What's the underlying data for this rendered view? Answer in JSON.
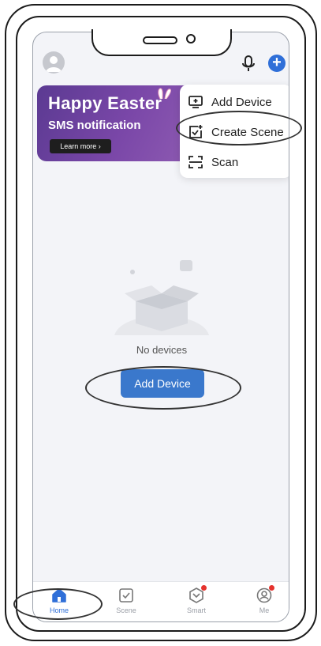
{
  "banner": {
    "title": "Happy Easter",
    "subtitle": "SMS notification",
    "button_label": "Learn more ›"
  },
  "menu": {
    "items": [
      {
        "label": "Add Device",
        "icon": "device-plus-icon"
      },
      {
        "label": "Create Scene",
        "icon": "scene-plus-icon"
      },
      {
        "label": "Scan",
        "icon": "scan-icon"
      }
    ]
  },
  "main": {
    "empty_text": "No devices",
    "add_device_label": "Add Device"
  },
  "tabbar": {
    "tabs": [
      {
        "label": "Home",
        "icon": "home-icon",
        "active": true
      },
      {
        "label": "Scene",
        "icon": "checkbox-icon",
        "active": false
      },
      {
        "label": "Smart",
        "icon": "smart-icon",
        "active": false
      },
      {
        "label": "Me",
        "icon": "profile-icon",
        "active": false
      }
    ]
  },
  "colors": {
    "accent": "#2f6fd8",
    "button": "#3a78cc",
    "badge": "#e5322d",
    "banner": "#6a42a0"
  }
}
